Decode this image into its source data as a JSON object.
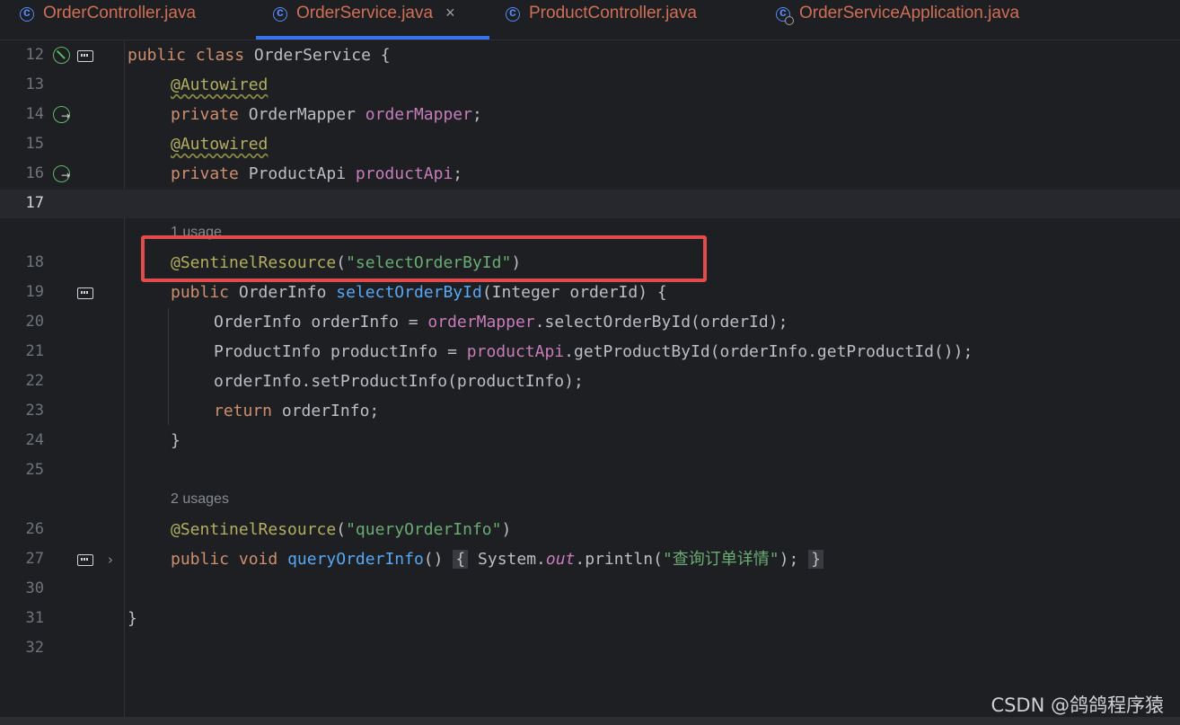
{
  "tabs": [
    {
      "label": "OrderController.java",
      "active": false
    },
    {
      "label": "OrderService.java",
      "active": true,
      "close": "×"
    },
    {
      "label": "ProductController.java",
      "active": false
    },
    {
      "label": "OrderServiceApplication.java",
      "active": false
    }
  ],
  "line_numbers": [
    "12",
    "13",
    "14",
    "15",
    "16",
    "17",
    "18",
    "19",
    "20",
    "21",
    "22",
    "23",
    "24",
    "25",
    "26",
    "27",
    "30",
    "31",
    "32"
  ],
  "hints": [
    "1 usage",
    "2 usages"
  ],
  "code": {
    "l12": {
      "kw1": "public",
      "kw2": "class",
      "name": "OrderService",
      "brace": "{"
    },
    "l13": {
      "ann": "@Autowired"
    },
    "l14": {
      "kw": "private",
      "type": "OrderMapper",
      "field": "orderMapper",
      "end": ";"
    },
    "l15": {
      "ann": "@Autowired"
    },
    "l16": {
      "kw": "private",
      "type": "ProductApi",
      "field": "productApi",
      "end": ";"
    },
    "l18": {
      "ann": "@SentinelResource",
      "open": "(",
      "str": "\"selectOrderById\"",
      "close": ")"
    },
    "l19": {
      "kw": "public",
      "type": "OrderInfo",
      "method": "selectOrderById",
      "params": "(Integer orderId) {"
    },
    "l20": {
      "pre": "OrderInfo orderInfo = ",
      "field": "orderMapper",
      "post": ".selectOrderById(orderId);"
    },
    "l21": {
      "pre": "ProductInfo productInfo = ",
      "field": "productApi",
      "post": ".getProductById(orderInfo.getProductId());"
    },
    "l22": {
      "text": "orderInfo.setProductInfo(productInfo);"
    },
    "l23": {
      "kw": "return",
      "text": " orderInfo;"
    },
    "l24": {
      "text": "}"
    },
    "l26": {
      "ann": "@SentinelResource",
      "open": "(",
      "str": "\"queryOrderInfo\"",
      "close": ")"
    },
    "l27": {
      "kw1": "public",
      "kw2": "void",
      "method": "queryOrderInfo",
      "parens": "()",
      "ob": "{",
      "sys": "System.",
      "out": "out",
      "print": ".println(",
      "str": "\"查询订单详情\"",
      "end": ");",
      "cb": "}"
    },
    "l31": {
      "text": "}"
    }
  },
  "watermark": "CSDN @鸽鸽程序猿"
}
